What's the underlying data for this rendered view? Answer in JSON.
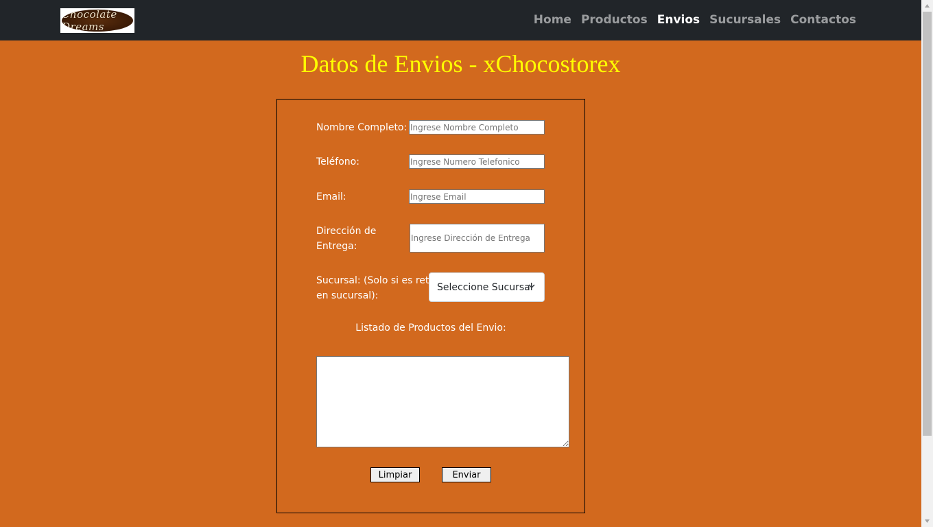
{
  "logo": {
    "text": "Chocolate Dreams"
  },
  "nav": {
    "items": [
      {
        "label": "Home",
        "active": false
      },
      {
        "label": "Productos",
        "active": false
      },
      {
        "label": "Envios",
        "active": true
      },
      {
        "label": "Sucursales",
        "active": false
      },
      {
        "label": "Contactos",
        "active": false
      }
    ]
  },
  "page": {
    "title": "Datos de Envios - xChocostorex"
  },
  "form": {
    "nombre": {
      "label": "Nombre Completo:",
      "placeholder": "Ingrese Nombre Completo",
      "value": ""
    },
    "telefono": {
      "label": "Teléfono:",
      "placeholder": "Ingrese Numero Telefonico",
      "value": ""
    },
    "email": {
      "label": "Email:",
      "placeholder": "Ingrese Email",
      "value": ""
    },
    "direccion": {
      "label_line1": "Dirección de",
      "label_line2": "Entrega:",
      "placeholder": "Ingrese Dirección de Entrega",
      "value": ""
    },
    "sucursal": {
      "label_line1": "Sucursal: (Solo si es retiro",
      "label_line2": "en sucursal):",
      "selected": "Seleccione Sucursal"
    },
    "productos": {
      "label": "Listado de Productos del Envio:",
      "value": ""
    },
    "buttons": {
      "limpiar": "Limpiar",
      "enviar": "Enviar"
    }
  },
  "colors": {
    "page_bg": "#d2691e",
    "navbar_bg": "#212529",
    "title": "#ffff00",
    "nav_active": "#ffffff",
    "nav_inactive": "rgba(255,255,255,0.55)"
  },
  "icons": {
    "select_arrow": "chevron-down-icon"
  }
}
